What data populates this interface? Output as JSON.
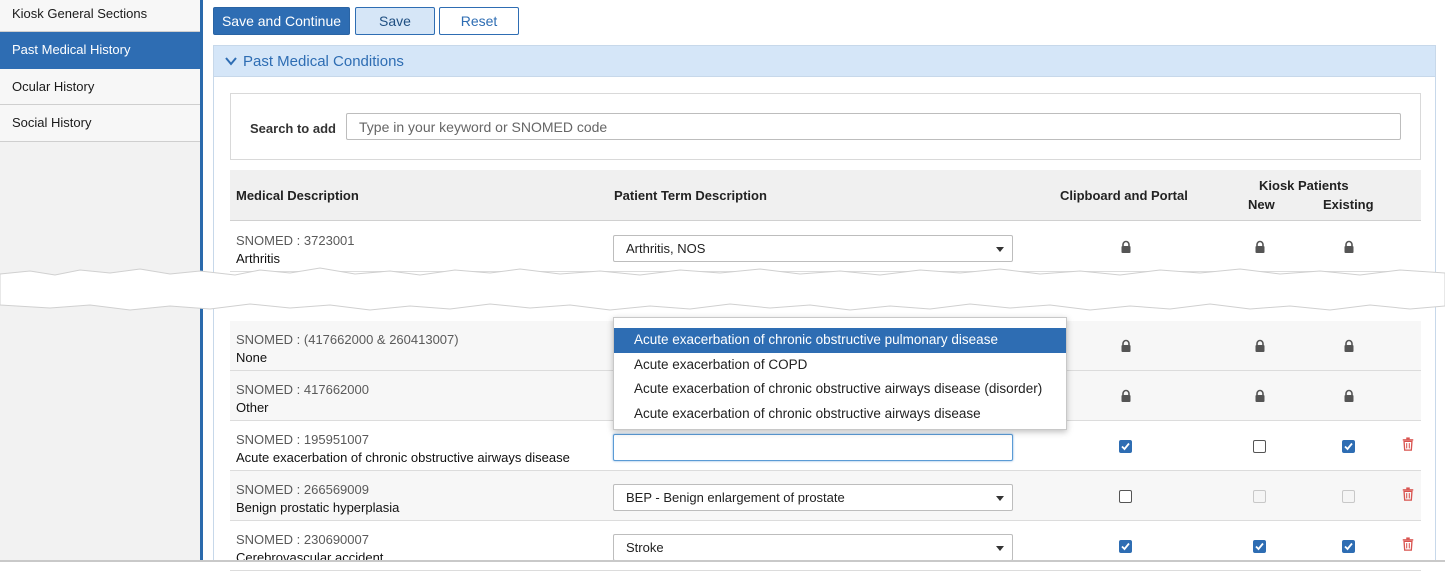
{
  "sidebar": {
    "items": [
      {
        "label": "Kiosk General Sections",
        "active": false
      },
      {
        "label": "Past Medical History",
        "active": true
      },
      {
        "label": "Ocular History",
        "active": false
      },
      {
        "label": "Social History",
        "active": false
      }
    ]
  },
  "toolbar": {
    "save_continue_label": "Save and Continue",
    "save_label": "Save",
    "reset_label": "Reset"
  },
  "panel": {
    "title": "Past Medical Conditions",
    "search_label": "Search to add",
    "search_placeholder": "Type in your keyword or SNOMED code"
  },
  "table": {
    "headers": {
      "medical": "Medical Description",
      "patient": "Patient Term Description",
      "clipboard": "Clipboard and Portal",
      "kiosk": "Kiosk Patients",
      "kiosk_new": "New",
      "kiosk_existing": "Existing"
    },
    "rows": [
      {
        "code": "SNOMED : 3723001",
        "desc": "Arthritis",
        "term": "Arthritis, NOS",
        "state": "locked"
      },
      {
        "code": "SNOMED : (417662000 & 260413007)",
        "desc": "None",
        "term": "",
        "state": "locked"
      },
      {
        "code": "SNOMED : 417662000",
        "desc": "Other",
        "term": "",
        "state": "locked"
      },
      {
        "code": "SNOMED : 195951007",
        "desc": "Acute exacerbation of chronic obstructive airways disease",
        "term": "",
        "clipboard": "checked",
        "new": "unchecked",
        "existing": "checked"
      },
      {
        "code": "SNOMED : 266569009",
        "desc": "Benign prostatic hyperplasia",
        "term": "BEP - Benign enlargement of prostate",
        "clipboard": "unchecked",
        "new": "disabled",
        "existing": "disabled"
      },
      {
        "code": "SNOMED : 230690007",
        "desc": "Cerebrovascular accident",
        "term": "Stroke",
        "clipboard": "checked",
        "new": "checked",
        "existing": "checked"
      }
    ]
  },
  "dropdown": {
    "options": [
      "Acute exacerbation of chronic obstructive pulmonary disease",
      "Acute exacerbation of COPD",
      "Acute exacerbation of chronic obstructive airways disease (disorder)",
      "Acute exacerbation of chronic obstructive airways disease"
    ],
    "highlighted_index": 0
  },
  "colors": {
    "accent": "#2e6db3",
    "delete": "#d9534f",
    "lock": "#555555"
  },
  "icons": {
    "lock": "lock-icon",
    "delete": "trash-icon",
    "chevron": "chevron-down-icon"
  }
}
